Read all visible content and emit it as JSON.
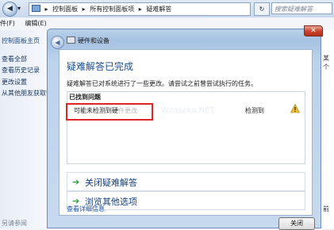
{
  "explorer": {
    "nav_back": "◀",
    "nav_dropdown": "▾",
    "address": {
      "icon": "control-panel-icon",
      "segments": [
        "控制面板",
        "所有控制面板项",
        "疑难解答"
      ],
      "separator": "▸"
    },
    "refresh_glyph": "↻",
    "search_placeholder": "搜索疑难解答",
    "menu": [
      "件(F)",
      "编辑(E)"
    ],
    "left_pane": {
      "home": "控制面板主页",
      "items": [
        "查看全部",
        "查看历史记录",
        "更改设置",
        "从其他朋友获取帮"
      ],
      "footer": "另请参阅"
    },
    "right_strip": [
      "某个",
      "前"
    ]
  },
  "dialog": {
    "close_glyph": "✕",
    "back_glyph": "◀",
    "crumb": "硬件和设备",
    "title": "疑难解答已完成",
    "description": "疑难解答已对系统进行了一些更改。请尝试之前曾尝试执行的任务。",
    "issues_panel": {
      "title": "已找到问题",
      "issue_name": "可能未检测到硬",
      "issue_name_ghost": "件更改",
      "watermark": "Wzasaka.NET",
      "issue_status": "检测到",
      "status_icon": "warning-icon"
    },
    "actions": [
      {
        "label": "关闭疑难解答",
        "icon": "green-arrow-icon"
      },
      {
        "label": "浏览其他选项",
        "icon": "green-arrow-icon"
      }
    ],
    "detail_link": "查看详细信息",
    "close_button": "关闭"
  },
  "colors": {
    "accent_title": "#1a4d8c",
    "highlight": "#e02323",
    "arrow": "#2aa13c",
    "warning": "#f2c12e"
  }
}
